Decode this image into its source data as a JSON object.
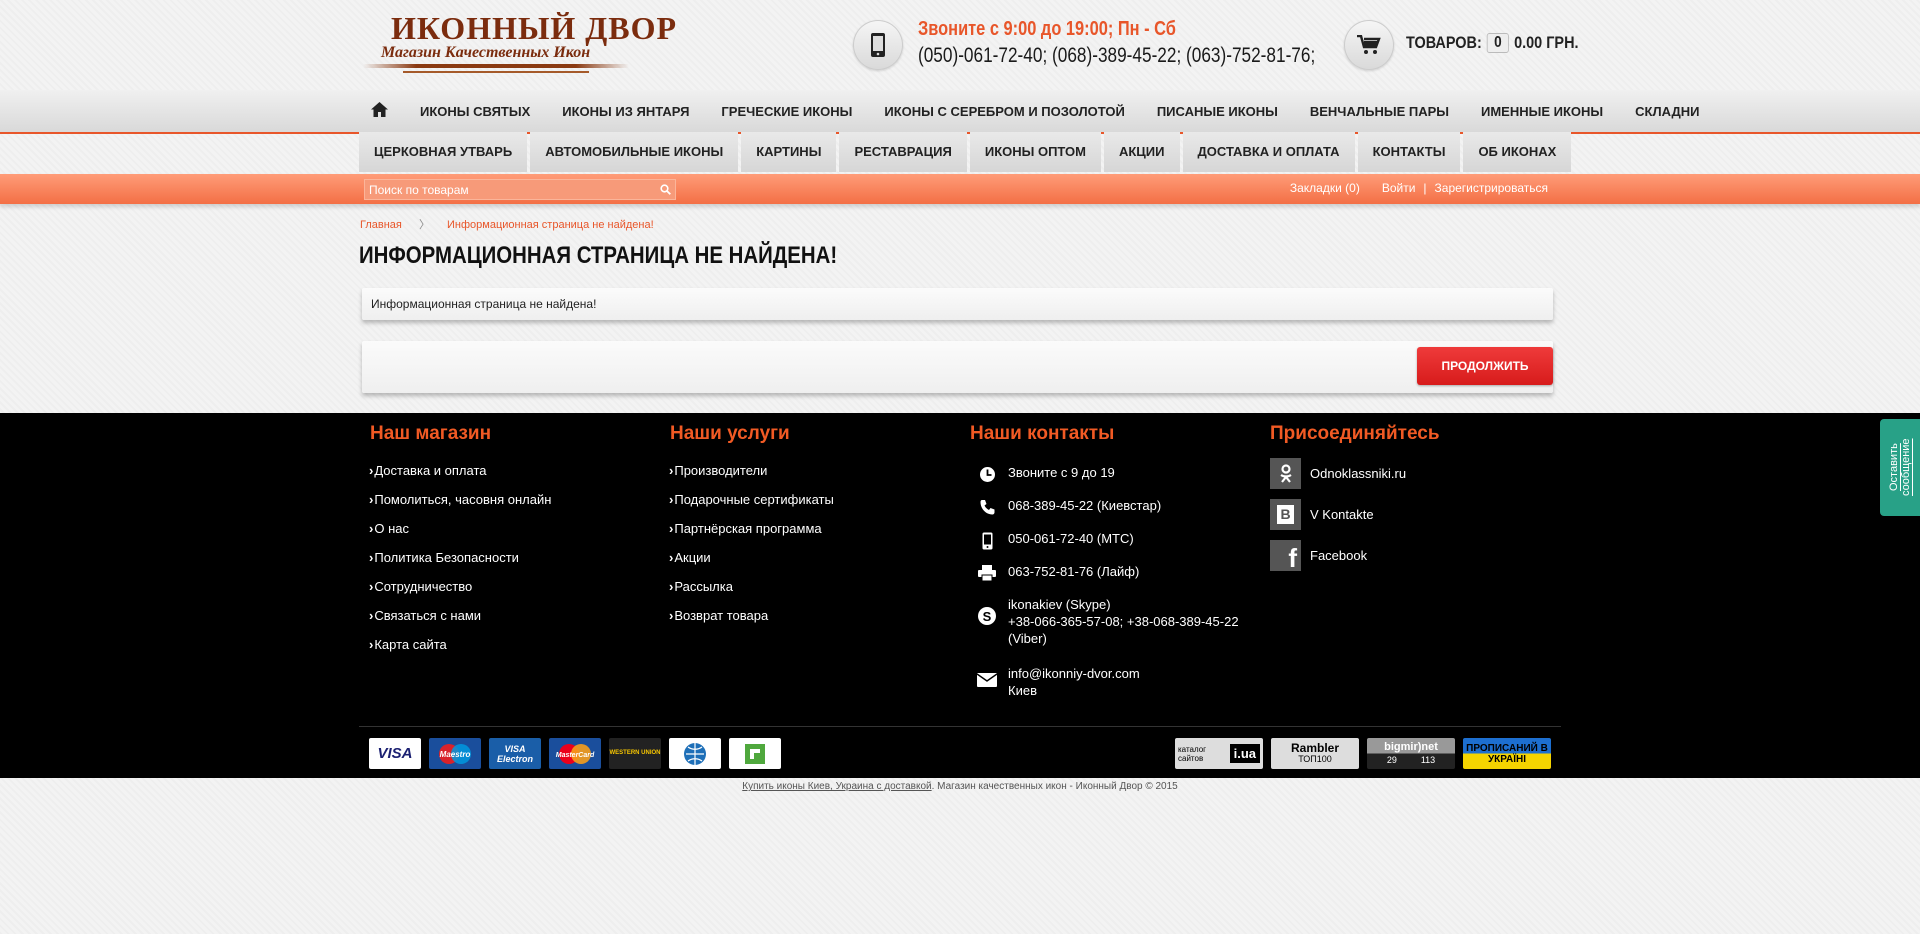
{
  "logo": {
    "title": "ИКОННЫЙ ДВОР",
    "subtitle": "Магазин Качественных Икон"
  },
  "header": {
    "hours": "Звоните с 9:00 до 19:00; Пн - Сб",
    "phones": "(050)-061-72-40; (068)-389-45-22; (063)-752-81-76;",
    "cart_label": "ТОВАРОВ:",
    "cart_count": "0",
    "cart_total": "0.00 ГРН."
  },
  "nav_top": [
    "ИКОНЫ СВЯТЫХ",
    "ИКОНЫ ИЗ ЯНТАРЯ",
    "ГРЕЧЕСКИЕ ИКОНЫ",
    "ИКОНЫ С СЕРЕБРОМ И ПОЗОЛОТОЙ",
    "ПИСАНЫЕ ИКОНЫ",
    "ВЕНЧАЛЬНЫЕ ПАРЫ",
    "ИМЕННЫЕ ИКОНЫ",
    "СКЛАДНИ"
  ],
  "nav_bottom": [
    "ЦЕРКОВНАЯ УТВАРЬ",
    "АВТОМОБИЛЬНЫЕ ИКОНЫ",
    "КАРТИНЫ",
    "РЕСТАВРАЦИЯ",
    "ИКОНЫ ОПТОМ",
    "АКЦИИ",
    "ДОСТАВКА И ОПЛАТА",
    "КОНТАКТЫ",
    "ОБ ИКОНАХ"
  ],
  "search": {
    "placeholder": "Поиск по товарам"
  },
  "topbar": {
    "bookmarks": "Закладки (0)",
    "login": "Войти",
    "separator": "|",
    "register": "Зарегистрироваться"
  },
  "breadcrumb": {
    "home": "Главная",
    "separator": "〉",
    "current": "Информационная страница не найдена!"
  },
  "page": {
    "title": "ИНФОРМАЦИОННАЯ СТРАНИЦА НЕ НАЙДЕНА!",
    "message": "Информационная страница не найдена!",
    "continue_label": "ПРОДОЛЖИТЬ"
  },
  "footer": {
    "shop": {
      "heading": "Наш магазин",
      "links": [
        "Доставка и оплата",
        "Помолиться, часовня онлайн",
        "О нас",
        "Политика Безопасности",
        "Сотрудничество",
        "Связаться с нами",
        "Карта сайта"
      ]
    },
    "services": {
      "heading": "Наши услуги",
      "links": [
        "Производители",
        "Подарочные сертификаты",
        "Партнёрская программа",
        "Акции",
        "Рассылка",
        "Возврат товара"
      ]
    },
    "contacts": {
      "heading": "Наши контакты",
      "hours": "Звоните с 9 до 19",
      "kyivstar": "068-389-45-22 (Киевстар)",
      "mts": "050-061-72-40 (МТС)",
      "life": "063-752-81-76 (Лайф)",
      "skype": "ikonakiev (Skype)",
      "viber": "+38-066-365-57-08; +38-068-389-45-22 (Viber)",
      "email": "info@ikonniy-dvor.com",
      "city": "Киев"
    },
    "social": {
      "heading": "Присоединяйтесь",
      "items": [
        "Odnoklassniki.ru",
        "V Kontakte",
        "Facebook"
      ]
    },
    "payments": [
      "VISA",
      "Maestro",
      "VISA Electron",
      "MasterCard",
      "WESTERN UNION"
    ],
    "counters": {
      "catalog": "каталог сайтов",
      "catalog_domain": "i.ua",
      "rambler": "Rambler",
      "rambler_sub": "ТОП100",
      "bigmir": "bigmir)net",
      "bigmir_a": "29",
      "bigmir_b": "113",
      "ukraine": "ПРОПИСАНИЙ В УКРАЇНІ"
    }
  },
  "copyright": {
    "link": "Купить иконы Киев, Украина с доставкой",
    "text": ". Магазин качественных икон - Иконный Двор © 2015"
  },
  "widget": {
    "label": "Оставить сообщение"
  }
}
